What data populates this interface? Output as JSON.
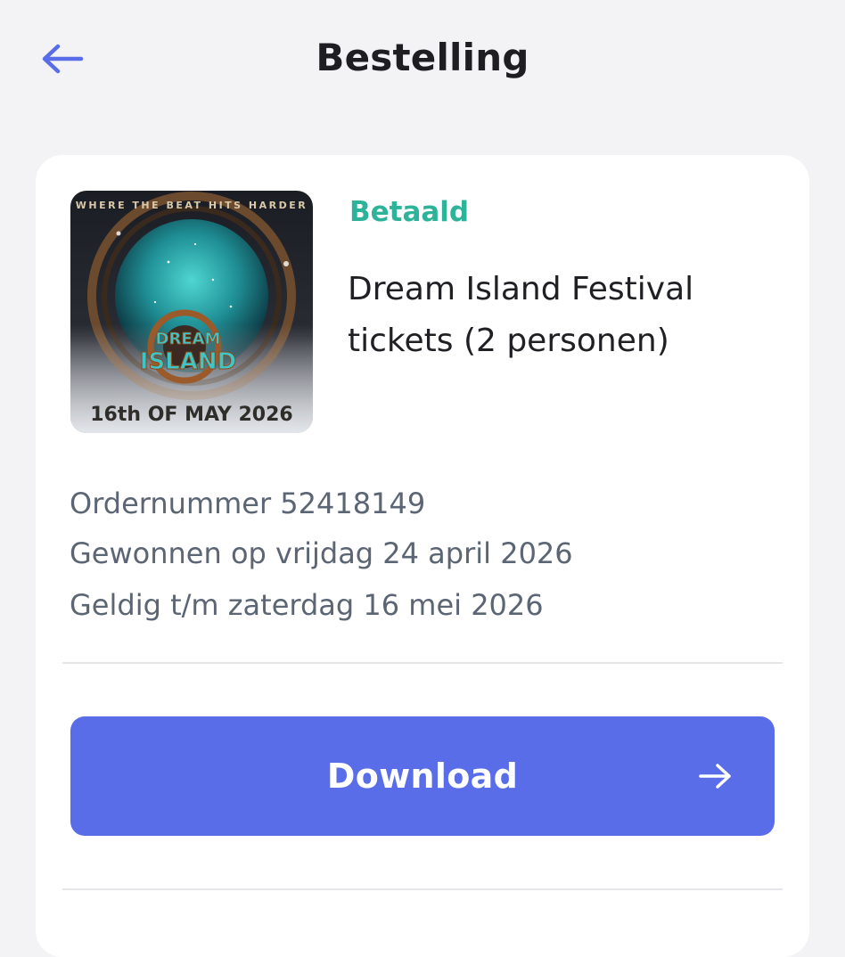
{
  "header": {
    "title": "Bestelling",
    "back_icon": "arrow-left-icon"
  },
  "order": {
    "status": "Betaald",
    "title_line1": "Dream Island Festival",
    "title_line2": "tickets (2 personen)",
    "order_number": "Ordernummer 52418149",
    "won_on": "Gewonnen op vrijdag 24 april 2026",
    "valid_until": "Geldig t/m zaterdag 16 mei 2026"
  },
  "poster": {
    "tagline": "WHERE THE BEAT HITS HARDER",
    "logo_line1": "DREAM",
    "logo_line2": "ISLAND",
    "date": "16th OF MAY 2026"
  },
  "actions": {
    "download_label": "Download",
    "download_icon": "arrow-right-icon"
  },
  "colors": {
    "accent": "#5a6de8",
    "status": "#2db39a",
    "meta_text": "#5b6573"
  }
}
